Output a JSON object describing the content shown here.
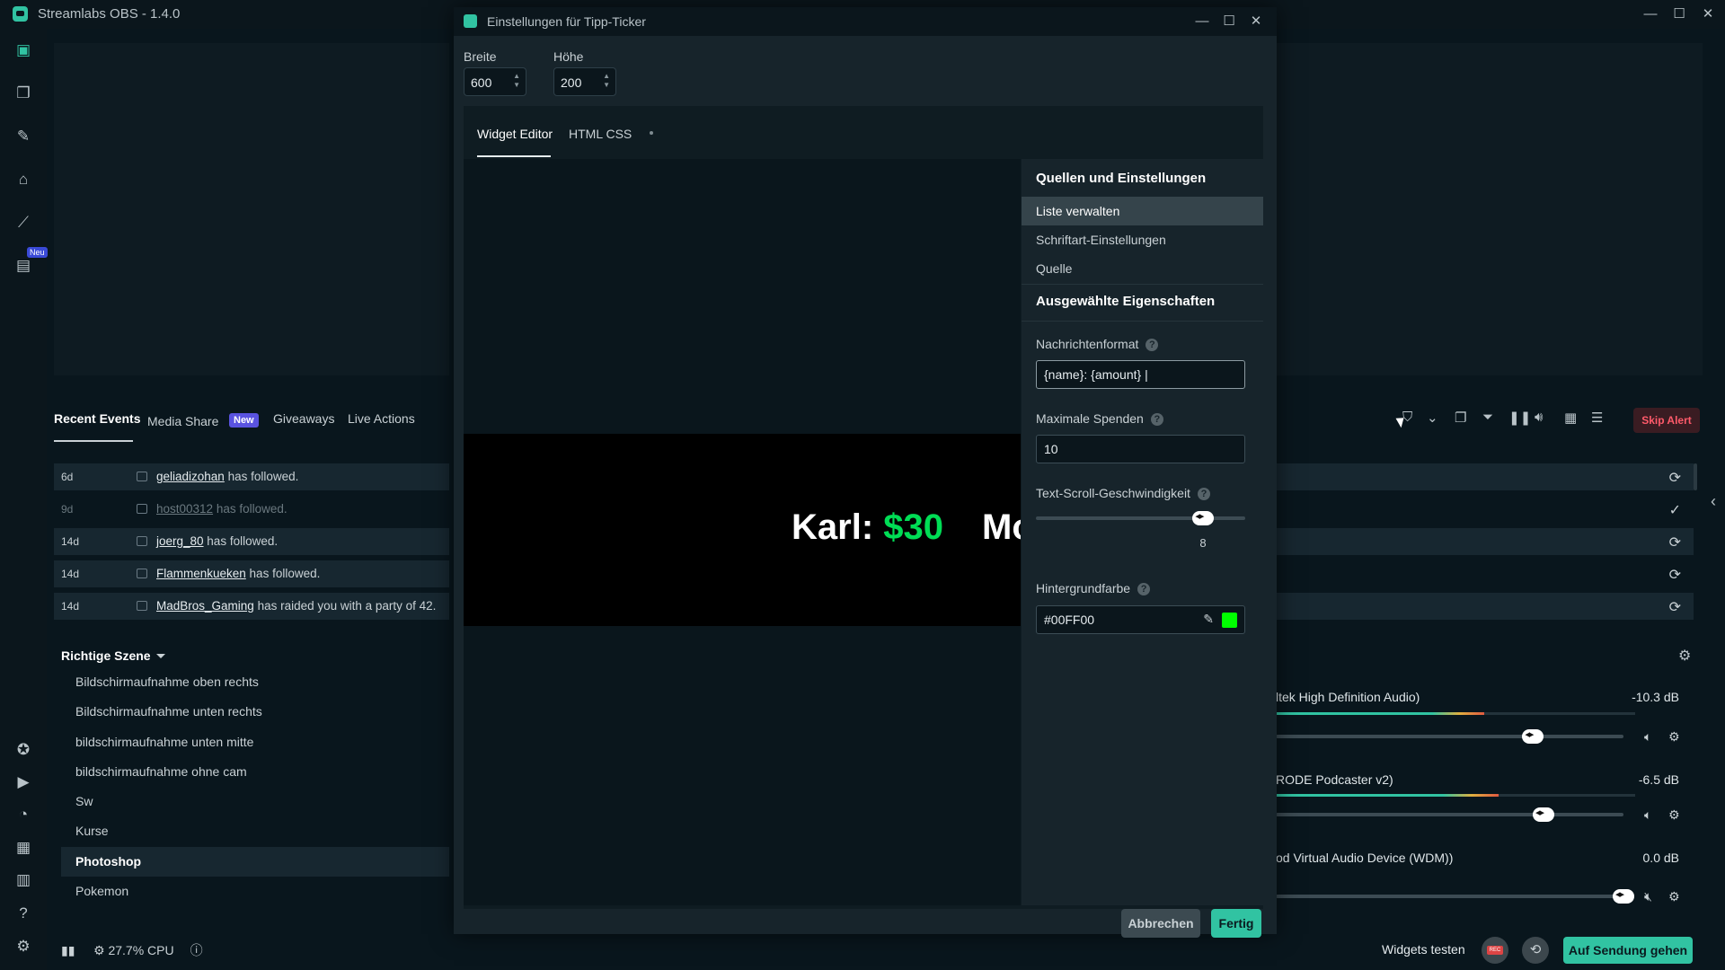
{
  "app": {
    "title": "Streamlabs OBS - 1.4.0"
  },
  "window_controls": {
    "minimize": "—",
    "maximize": "☐",
    "close": "✕"
  },
  "nav": {
    "neu_badge": "Neu"
  },
  "events": {
    "tabs": [
      "Recent Events",
      "Media Share",
      "Giveaways",
      "Live Actions"
    ],
    "new_badge": "New",
    "rows": [
      {
        "age": "6d",
        "user": "geliadizohan",
        "text": " has followed."
      },
      {
        "age": "9d",
        "user": "host00312",
        "text": " has followed."
      },
      {
        "age": "14d",
        "user": "joerg_80",
        "text": " has followed."
      },
      {
        "age": "14d",
        "user": "Flammenkueken",
        "text": " has followed."
      },
      {
        "age": "14d",
        "user": "MadBros_Gaming",
        "text": " has raided you with a party of 42."
      }
    ]
  },
  "scenes": {
    "collection": "Richtige Szene",
    "items": [
      "Bildschirmaufnahme oben rechts",
      "Bildschirmaufnahme unten rechts",
      "bildschirmaufnahme unten mitte",
      "bildschirmaufnahme ohne cam",
      "Sw",
      "Kurse",
      "Photoshop",
      "Pokemon"
    ],
    "active": "Photoshop"
  },
  "alerts": {
    "skip_label": "Skip Alert"
  },
  "mixer": {
    "sources": [
      {
        "name": "ltek High Definition Audio)",
        "db": "-10.3 dB",
        "level": 0.58,
        "volume": 0.74
      },
      {
        "name": "RODE Podcaster v2)",
        "db": "-6.5 dB",
        "level": 0.62,
        "volume": 0.77
      },
      {
        "name": "od Virtual Audio Device (WDM))",
        "db": "0.0 dB",
        "level": 0,
        "volume": 1.0
      }
    ]
  },
  "status": {
    "cpu": "27.7% CPU"
  },
  "footer": {
    "widgets_test": "Widgets testen",
    "rec_label": "REC",
    "go_live": "Auf Sendung gehen"
  },
  "modal": {
    "title": "Einstellungen für Tipp-Ticker",
    "width_label": "Breite",
    "width_value": "600",
    "height_label": "Höhe",
    "height_value": "200",
    "tabs": [
      "Widget Editor",
      "HTML CSS"
    ],
    "ticker": {
      "name": "Karl: ",
      "amount": "$30",
      "next": "Mo"
    },
    "sidebar": {
      "sources_heading": "Quellen und Einstellungen",
      "items": [
        "Liste verwalten",
        "Schriftart-Einstellungen",
        "Quelle"
      ],
      "active_item": "Liste verwalten",
      "props_heading": "Ausgewählte Eigenschaften",
      "message_format_label": "Nachrichtenformat",
      "message_format_value": "{name}: {amount}",
      "max_donations_label": "Maximale Spenden",
      "max_donations_value": "10",
      "scroll_speed_label": "Text-Scroll-Geschwindigkeit",
      "scroll_speed_value": "8",
      "scroll_speed_fraction": 0.8,
      "bg_color_label": "Hintergrundfarbe",
      "bg_color_value": "#00FF00"
    },
    "cancel_label": "Abbrechen",
    "done_label": "Fertig"
  },
  "colors": {
    "accent": "#31c3a2",
    "ticker_amount": "#00dd55",
    "swatch": "#00FF00",
    "skip_alert": "#ff5a6a"
  }
}
